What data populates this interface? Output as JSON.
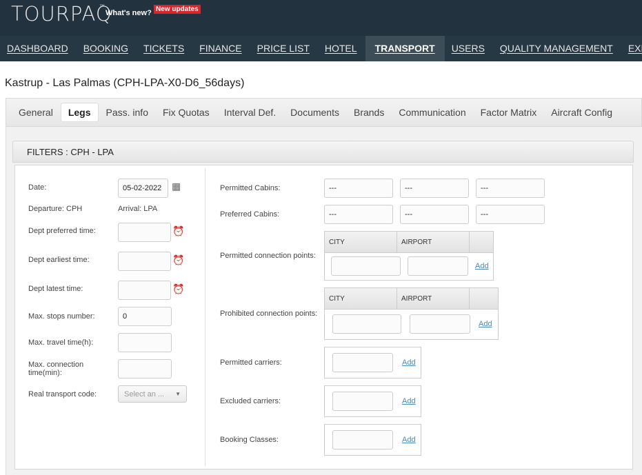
{
  "header": {
    "logo": "TOURPAQ",
    "tm": "™",
    "whats_new": "What's new?",
    "new_updates": "New updates"
  },
  "nav": [
    "DASHBOARD",
    "BOOKING",
    "TICKETS",
    "FINANCE",
    "PRICE LIST",
    "HOTEL",
    "TRANSPORT",
    "USERS",
    "QUALITY MANAGEMENT",
    "EXPORT"
  ],
  "nav_active": "TRANSPORT",
  "page_title": "Kastrup - Las Palmas (CPH-LPA-X0-D6_56days)",
  "tabs": [
    "General",
    "Legs",
    "Pass. info",
    "Fix Quotas",
    "Interval Def.",
    "Documents",
    "Brands",
    "Communication",
    "Factor Matrix",
    "Aircraft Config"
  ],
  "active_tab": "Legs",
  "filters": {
    "title": "FILTERS : CPH - LPA",
    "date_label": "Date:",
    "date_value": "05-02-2022",
    "departure": "Departure: CPH",
    "arrival": "Arrival: LPA",
    "dept_preferred": "Dept preferred time:",
    "dept_earliest": "Dept earliest time:",
    "dept_latest": "Dept latest time:",
    "max_stops": "Max. stops number:",
    "max_stops_value": "0",
    "max_travel": "Max. travel time(h):",
    "max_connection": "Max. connection time(min):",
    "real_transport": "Real transport code:",
    "real_transport_placeholder": "Select an ...",
    "permitted_cabins": "Permitted Cabins:",
    "preferred_cabins": "Preferred Cabins:",
    "cabin_value": "---",
    "permitted_conn": "Permitted connection points:",
    "prohibited_conn": "Prohibited connection points:",
    "city": "CITY",
    "airport": "AIRPORT",
    "add": "Add",
    "permitted_carriers": "Permitted carriers:",
    "excluded_carriers": "Excluded carriers:",
    "booking_classes": "Booking Classes:"
  },
  "colors": {
    "header_bg": "#22333f",
    "nav_active_bg": "#3c4d57",
    "badge": "#d9262b",
    "link": "#4a8ab5"
  }
}
